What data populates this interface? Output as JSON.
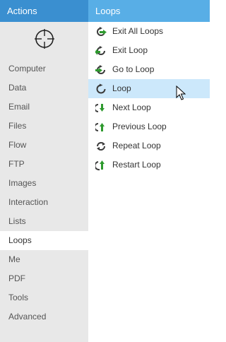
{
  "left_panel": {
    "title": "Actions",
    "target_icon": "crosshair-target-icon",
    "categories": [
      {
        "label": "Computer"
      },
      {
        "label": "Data"
      },
      {
        "label": "Email"
      },
      {
        "label": "Files"
      },
      {
        "label": "Flow"
      },
      {
        "label": "FTP"
      },
      {
        "label": "Images"
      },
      {
        "label": "Interaction"
      },
      {
        "label": "Lists"
      },
      {
        "label": "Loops",
        "selected": true
      },
      {
        "label": "Me"
      },
      {
        "label": "PDF"
      },
      {
        "label": "Tools"
      },
      {
        "label": "Advanced"
      }
    ]
  },
  "right_panel": {
    "title": "Loops",
    "items": [
      {
        "label": "Exit All Loops",
        "icon": "exit-all-loops-icon"
      },
      {
        "label": "Exit Loop",
        "icon": "exit-loop-icon"
      },
      {
        "label": "Go to Loop",
        "icon": "go-to-loop-icon"
      },
      {
        "label": "Loop",
        "icon": "loop-icon",
        "selected": true
      },
      {
        "label": "Next Loop",
        "icon": "next-loop-icon"
      },
      {
        "label": "Previous Loop",
        "icon": "previous-loop-icon"
      },
      {
        "label": "Repeat Loop",
        "icon": "repeat-loop-icon"
      },
      {
        "label": "Restart Loop",
        "icon": "restart-loop-icon"
      }
    ]
  },
  "colors": {
    "left_header": "#3a8fd0",
    "right_header": "#58aee6",
    "selection": "#cce8fb",
    "icon_green": "#2e9a2e",
    "icon_dark": "#3a3a3a"
  }
}
